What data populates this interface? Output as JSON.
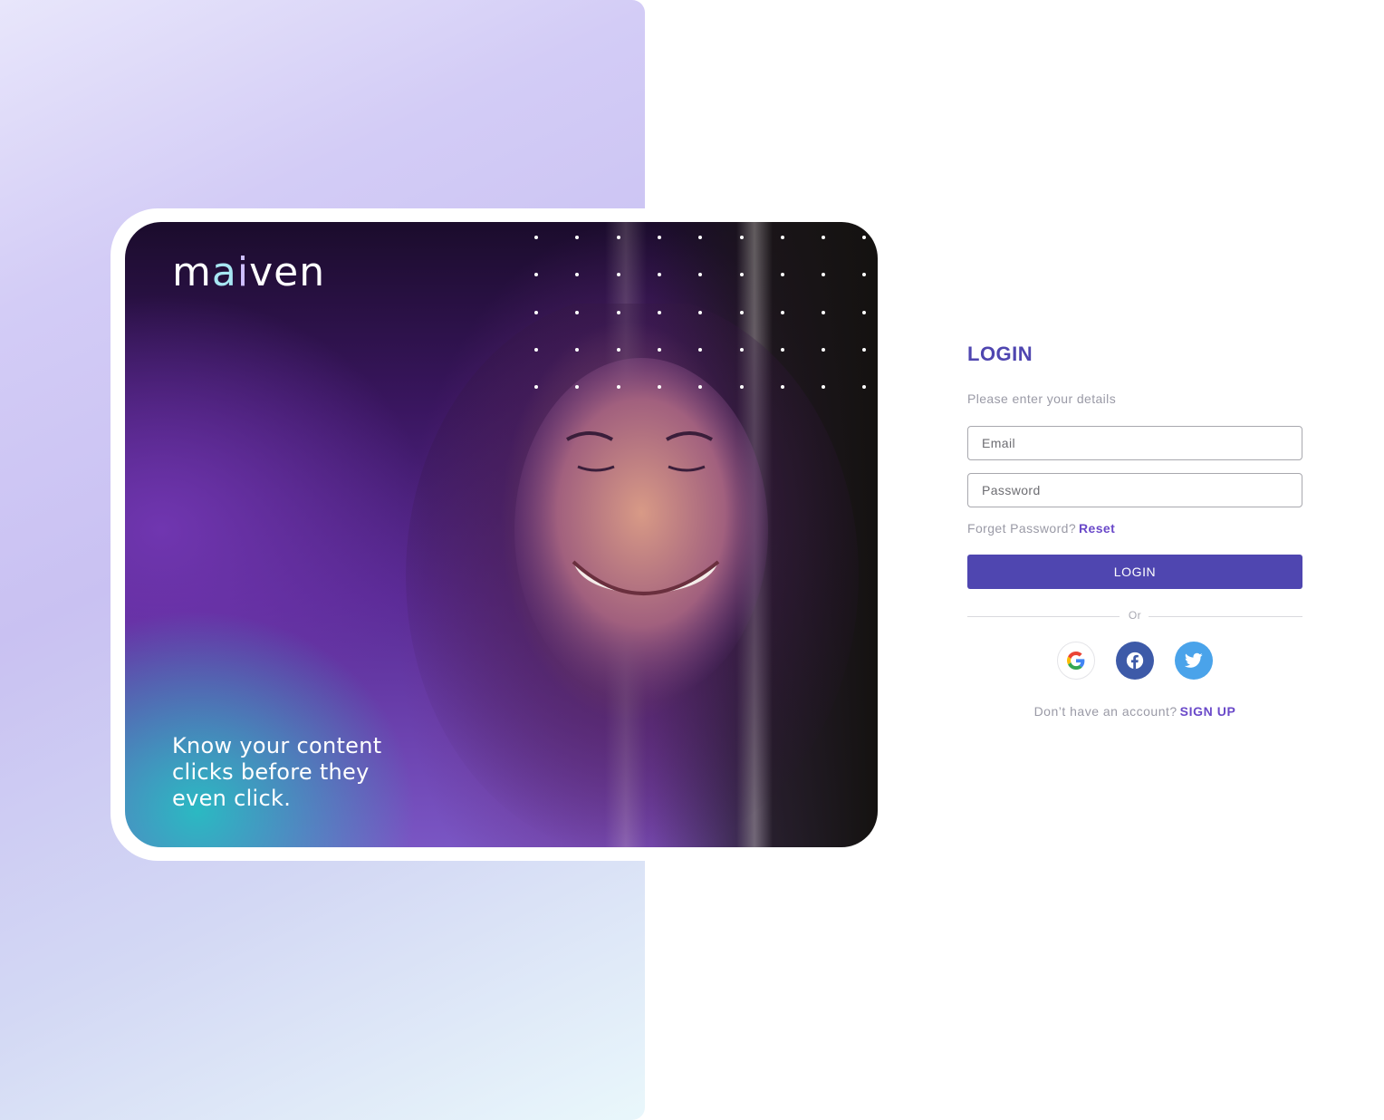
{
  "brand": {
    "logo_m": "m",
    "logo_a": "a",
    "logo_i": "i",
    "logo_rest": "ven",
    "tagline": "Know your content clicks before they even click."
  },
  "login": {
    "title": "LOGIN",
    "subtitle": "Please enter your details",
    "email_placeholder": "Email",
    "password_placeholder": "Password",
    "forgot_text": "Forget Password?",
    "reset_link": "Reset",
    "submit_label": "LOGIN",
    "divider_text": "Or",
    "social": [
      {
        "name": "google",
        "icon": "google-icon"
      },
      {
        "name": "facebook",
        "icon": "facebook-icon"
      },
      {
        "name": "twitter",
        "icon": "twitter-icon"
      }
    ],
    "signup_prompt": "Don’t have an account?",
    "signup_link": "SIGN UP"
  },
  "colors": {
    "accent": "#4f46b0",
    "link": "#6a49c9",
    "facebook": "#3d5aa8",
    "twitter": "#4aa3ea"
  }
}
